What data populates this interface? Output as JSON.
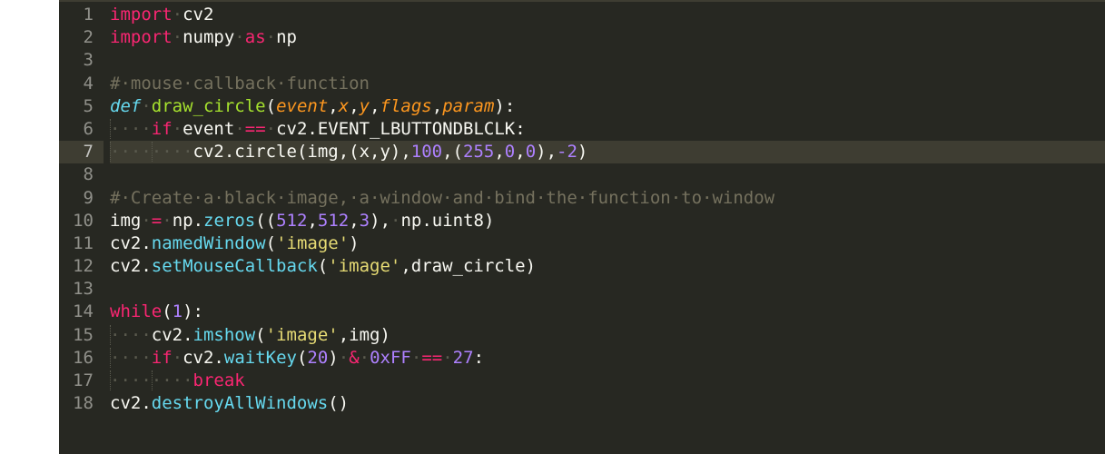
{
  "colors": {
    "background": "#272822",
    "default": "#f8f8f2",
    "keyword": "#f92672",
    "storage": "#66d9ef",
    "function": "#a6e22e",
    "param": "#fd971f",
    "number": "#ae81ff",
    "string": "#e6db74",
    "comment": "#75715e",
    "whitespace": "#5a5a4e"
  },
  "editor": {
    "active_line": 7,
    "lines": [
      {
        "number": "1",
        "tokens": [
          {
            "t": "import",
            "c": "keyword"
          },
          {
            "t": "·",
            "c": "whitespace"
          },
          {
            "t": "cv2",
            "c": "default"
          }
        ]
      },
      {
        "number": "2",
        "tokens": [
          {
            "t": "import",
            "c": "keyword"
          },
          {
            "t": "·",
            "c": "whitespace"
          },
          {
            "t": "numpy",
            "c": "default"
          },
          {
            "t": "·",
            "c": "whitespace"
          },
          {
            "t": "as",
            "c": "keyword"
          },
          {
            "t": "·",
            "c": "whitespace"
          },
          {
            "t": "np",
            "c": "default"
          }
        ]
      },
      {
        "number": "3",
        "tokens": []
      },
      {
        "number": "4",
        "tokens": [
          {
            "t": "#·mouse·callback·function",
            "c": "comment"
          }
        ]
      },
      {
        "number": "5",
        "tokens": [
          {
            "t": "def",
            "c": "storage",
            "i": true
          },
          {
            "t": "·",
            "c": "whitespace"
          },
          {
            "t": "draw_circle",
            "c": "function"
          },
          {
            "t": "(",
            "c": "default"
          },
          {
            "t": "event",
            "c": "param",
            "i": true
          },
          {
            "t": ",",
            "c": "default"
          },
          {
            "t": "x",
            "c": "param",
            "i": true
          },
          {
            "t": ",",
            "c": "default"
          },
          {
            "t": "y",
            "c": "param",
            "i": true
          },
          {
            "t": ",",
            "c": "default"
          },
          {
            "t": "flags",
            "c": "param",
            "i": true
          },
          {
            "t": ",",
            "c": "default"
          },
          {
            "t": "param",
            "c": "param",
            "i": true
          },
          {
            "t": "):",
            "c": "default"
          }
        ]
      },
      {
        "number": "6",
        "tokens": [
          {
            "t": "····",
            "c": "whitespace",
            "g": true
          },
          {
            "t": "if",
            "c": "keyword"
          },
          {
            "t": "·",
            "c": "whitespace"
          },
          {
            "t": "event",
            "c": "default"
          },
          {
            "t": "·",
            "c": "whitespace"
          },
          {
            "t": "==",
            "c": "keyword"
          },
          {
            "t": "·",
            "c": "whitespace"
          },
          {
            "t": "cv2.EVENT_LBUTTONDBLCLK:",
            "c": "default"
          }
        ]
      },
      {
        "number": "7",
        "tokens": [
          {
            "t": "····",
            "c": "whitespace",
            "g": true
          },
          {
            "t": "····",
            "c": "whitespace",
            "g": true
          },
          {
            "t": "cv2.",
            "c": "default"
          },
          {
            "t": "circle",
            "c": "default"
          },
          {
            "t": "(img,(x,y),",
            "c": "default"
          },
          {
            "t": "100",
            "c": "number"
          },
          {
            "t": ",(",
            "c": "default"
          },
          {
            "t": "255",
            "c": "number"
          },
          {
            "t": ",",
            "c": "default"
          },
          {
            "t": "0",
            "c": "number"
          },
          {
            "t": ",",
            "c": "default"
          },
          {
            "t": "0",
            "c": "number"
          },
          {
            "t": "),",
            "c": "default"
          },
          {
            "t": "-2",
            "c": "number"
          },
          {
            "t": ")",
            "c": "default"
          }
        ]
      },
      {
        "number": "8",
        "tokens": []
      },
      {
        "number": "9",
        "tokens": [
          {
            "t": "#·Create·a·black·image,·a·window·and·bind·the·function·to·window",
            "c": "comment"
          }
        ]
      },
      {
        "number": "10",
        "tokens": [
          {
            "t": "img",
            "c": "default"
          },
          {
            "t": "·",
            "c": "whitespace"
          },
          {
            "t": "=",
            "c": "keyword"
          },
          {
            "t": "·",
            "c": "whitespace"
          },
          {
            "t": "np.",
            "c": "default"
          },
          {
            "t": "zeros",
            "c": "storage"
          },
          {
            "t": "((",
            "c": "default"
          },
          {
            "t": "512",
            "c": "number"
          },
          {
            "t": ",",
            "c": "default"
          },
          {
            "t": "512",
            "c": "number"
          },
          {
            "t": ",",
            "c": "default"
          },
          {
            "t": "3",
            "c": "number"
          },
          {
            "t": "),",
            "c": "default"
          },
          {
            "t": "·",
            "c": "whitespace"
          },
          {
            "t": "np.uint8)",
            "c": "default"
          }
        ]
      },
      {
        "number": "11",
        "tokens": [
          {
            "t": "cv2.",
            "c": "default"
          },
          {
            "t": "namedWindow",
            "c": "storage"
          },
          {
            "t": "(",
            "c": "default"
          },
          {
            "t": "'image'",
            "c": "string"
          },
          {
            "t": ")",
            "c": "default"
          }
        ]
      },
      {
        "number": "12",
        "tokens": [
          {
            "t": "cv2.",
            "c": "default"
          },
          {
            "t": "setMouseCallback",
            "c": "storage"
          },
          {
            "t": "(",
            "c": "default"
          },
          {
            "t": "'image'",
            "c": "string"
          },
          {
            "t": ",draw_circle)",
            "c": "default"
          }
        ]
      },
      {
        "number": "13",
        "tokens": []
      },
      {
        "number": "14",
        "tokens": [
          {
            "t": "while",
            "c": "keyword"
          },
          {
            "t": "(",
            "c": "default"
          },
          {
            "t": "1",
            "c": "number"
          },
          {
            "t": "):",
            "c": "default"
          }
        ]
      },
      {
        "number": "15",
        "tokens": [
          {
            "t": "····",
            "c": "whitespace",
            "g": true
          },
          {
            "t": "cv2.",
            "c": "default"
          },
          {
            "t": "imshow",
            "c": "storage"
          },
          {
            "t": "(",
            "c": "default"
          },
          {
            "t": "'image'",
            "c": "string"
          },
          {
            "t": ",img)",
            "c": "default"
          }
        ]
      },
      {
        "number": "16",
        "tokens": [
          {
            "t": "····",
            "c": "whitespace",
            "g": true
          },
          {
            "t": "if",
            "c": "keyword"
          },
          {
            "t": "·",
            "c": "whitespace"
          },
          {
            "t": "cv2.",
            "c": "default"
          },
          {
            "t": "waitKey",
            "c": "storage"
          },
          {
            "t": "(",
            "c": "default"
          },
          {
            "t": "20",
            "c": "number"
          },
          {
            "t": ")",
            "c": "default"
          },
          {
            "t": "·",
            "c": "whitespace"
          },
          {
            "t": "&",
            "c": "keyword"
          },
          {
            "t": "·",
            "c": "whitespace"
          },
          {
            "t": "0xFF",
            "c": "number"
          },
          {
            "t": "·",
            "c": "whitespace"
          },
          {
            "t": "==",
            "c": "keyword"
          },
          {
            "t": "·",
            "c": "whitespace"
          },
          {
            "t": "27",
            "c": "number"
          },
          {
            "t": ":",
            "c": "default"
          }
        ]
      },
      {
        "number": "17",
        "tokens": [
          {
            "t": "····",
            "c": "whitespace",
            "g": true
          },
          {
            "t": "····",
            "c": "whitespace",
            "g": true
          },
          {
            "t": "break",
            "c": "keyword"
          }
        ]
      },
      {
        "number": "18",
        "tokens": [
          {
            "t": "cv2.",
            "c": "default"
          },
          {
            "t": "destroyAllWindows",
            "c": "storage"
          },
          {
            "t": "()",
            "c": "default"
          }
        ]
      }
    ]
  }
}
